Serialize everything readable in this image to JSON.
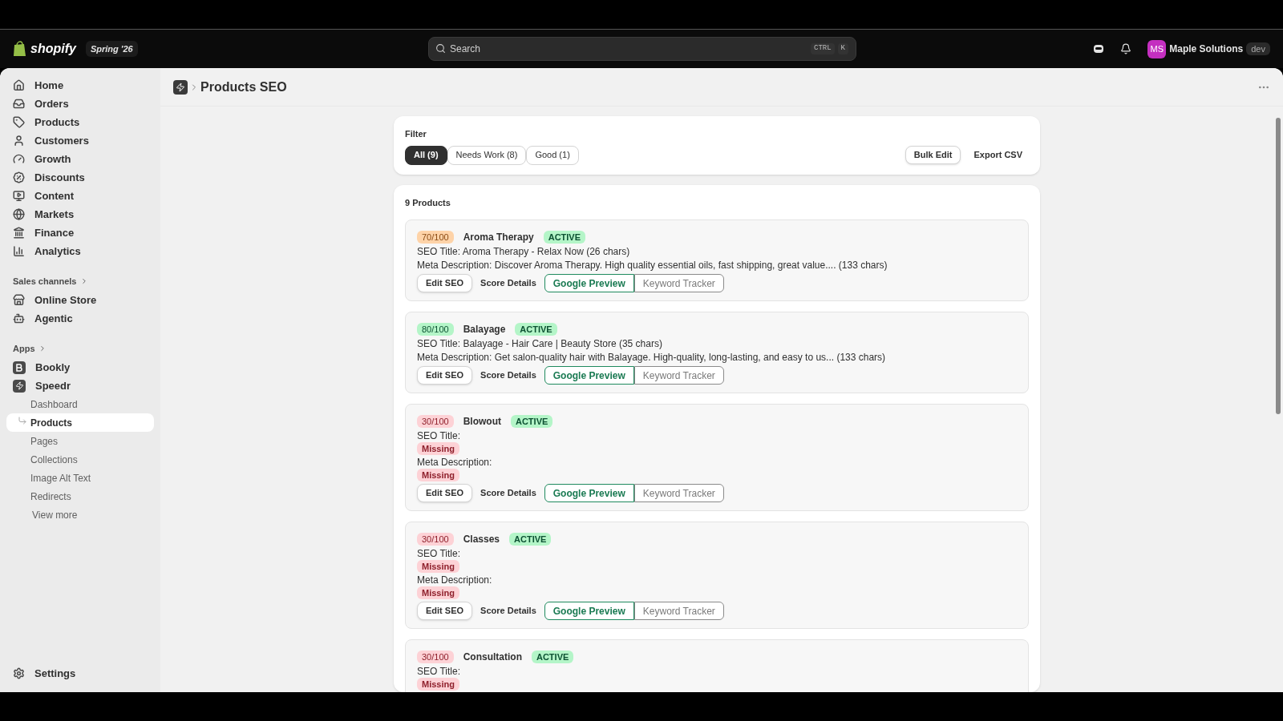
{
  "topbar": {
    "brand": "shopify",
    "edition": "Spring '26",
    "search": {
      "placeholder": "Search",
      "shortcut": [
        "CTRL",
        "K"
      ]
    },
    "account": {
      "initials": "MS",
      "name": "Maple Solutions",
      "badge": "dev"
    }
  },
  "sidebar": {
    "items": [
      {
        "label": "Home",
        "selected": false
      },
      {
        "label": "Orders",
        "selected": false
      },
      {
        "label": "Products",
        "selected": false
      },
      {
        "label": "Customers",
        "selected": false
      },
      {
        "label": "Growth",
        "selected": false
      },
      {
        "label": "Discounts",
        "selected": false
      },
      {
        "label": "Content",
        "selected": false
      },
      {
        "label": "Markets",
        "selected": false
      },
      {
        "label": "Finance",
        "selected": false
      },
      {
        "label": "Analytics",
        "selected": false
      }
    ],
    "sections": [
      {
        "title": "Sales channels",
        "items": [
          {
            "label": "Online Store",
            "selected": false
          },
          {
            "label": "Agentic",
            "selected": false
          }
        ]
      },
      {
        "title": "Apps",
        "items": [
          {
            "label": "Bookly",
            "selected": false
          },
          {
            "label": "Speedr",
            "selected": false,
            "children": [
              {
                "label": "Dashboard",
                "selected": false
              },
              {
                "label": "Products",
                "selected": true
              },
              {
                "label": "Pages",
                "selected": false
              },
              {
                "label": "Collections",
                "selected": false
              },
              {
                "label": "Image Alt Text",
                "selected": false
              },
              {
                "label": "Redirects",
                "selected": false
              }
            ]
          }
        ]
      }
    ],
    "view_more": "View more",
    "settings": "Settings"
  },
  "page": {
    "title": "Products SEO"
  },
  "filter": {
    "label": "Filter",
    "tabs": [
      {
        "label": "All (9)",
        "selected": true
      },
      {
        "label": "Needs Work (8)",
        "selected": false
      },
      {
        "label": "Good (1)",
        "selected": false
      }
    ],
    "actions": [
      {
        "label": "Bulk Edit",
        "kind": "outline"
      },
      {
        "label": "Export CSV",
        "kind": "plain"
      }
    ]
  },
  "products": {
    "count": "9 Products",
    "items": [
      {
        "score": "70/100",
        "color": "#fed3a8",
        "name": "Aroma Therapy",
        "status": "ACTIVE",
        "seo_title": {
          "label": "SEO Title:",
          "value": "Aroma Therapy - Relax Now (26 chars)"
        },
        "meta": {
          "label": "Meta Description:",
          "value": "Discover Aroma Therapy. High quality essential oils, fast shipping, great value.... (133 chars)"
        },
        "actions": [
          {
            "label": "Edit SEO",
            "kind": "outline"
          },
          {
            "label": "Score Details",
            "kind": "plain"
          },
          {
            "label": "Google Preview",
            "kind": "primary"
          },
          {
            "label": "Keyword Tracker",
            "kind": "muted"
          }
        ]
      },
      {
        "score": "80/100",
        "color": "#b4f5c8",
        "name": "Balayage",
        "status": "ACTIVE",
        "seo_title": {
          "label": "SEO Title:",
          "value": "Balayage - Hair Care | Beauty Store (35 chars)"
        },
        "meta": {
          "label": "Meta Description:",
          "value": "Get salon-quality hair with Balayage. High-quality, long-lasting, and easy to us... (133 chars)"
        },
        "actions": [
          {
            "label": "Edit SEO",
            "kind": "outline"
          },
          {
            "label": "Score Details",
            "kind": "plain"
          },
          {
            "label": "Google Preview",
            "kind": "primary"
          },
          {
            "label": "Keyword Tracker",
            "kind": "muted"
          }
        ]
      },
      {
        "score": "30/100",
        "color": "#fdd2d6",
        "name": "Blowout",
        "status": "ACTIVE",
        "seo_title": {
          "label": "SEO Title:",
          "missing": "Missing"
        },
        "meta": {
          "label": "Meta Description:",
          "missing": "Missing"
        },
        "actions": [
          {
            "label": "Edit SEO",
            "kind": "outline"
          },
          {
            "label": "Score Details",
            "kind": "plain"
          },
          {
            "label": "Google Preview",
            "kind": "primary"
          },
          {
            "label": "Keyword Tracker",
            "kind": "muted"
          }
        ]
      },
      {
        "score": "30/100",
        "color": "#fdd2d6",
        "name": "Classes",
        "status": "ACTIVE",
        "seo_title": {
          "label": "SEO Title:",
          "missing": "Missing"
        },
        "meta": {
          "label": "Meta Description:",
          "missing": "Missing"
        },
        "actions": [
          {
            "label": "Edit SEO",
            "kind": "outline"
          },
          {
            "label": "Score Details",
            "kind": "plain"
          },
          {
            "label": "Google Preview",
            "kind": "primary"
          },
          {
            "label": "Keyword Tracker",
            "kind": "muted"
          }
        ]
      },
      {
        "score": "30/100",
        "color": "#fdd2d6",
        "name": "Consultation",
        "status": "ACTIVE",
        "seo_title": {
          "label": "SEO Title:",
          "missing": "Missing"
        }
      }
    ]
  }
}
